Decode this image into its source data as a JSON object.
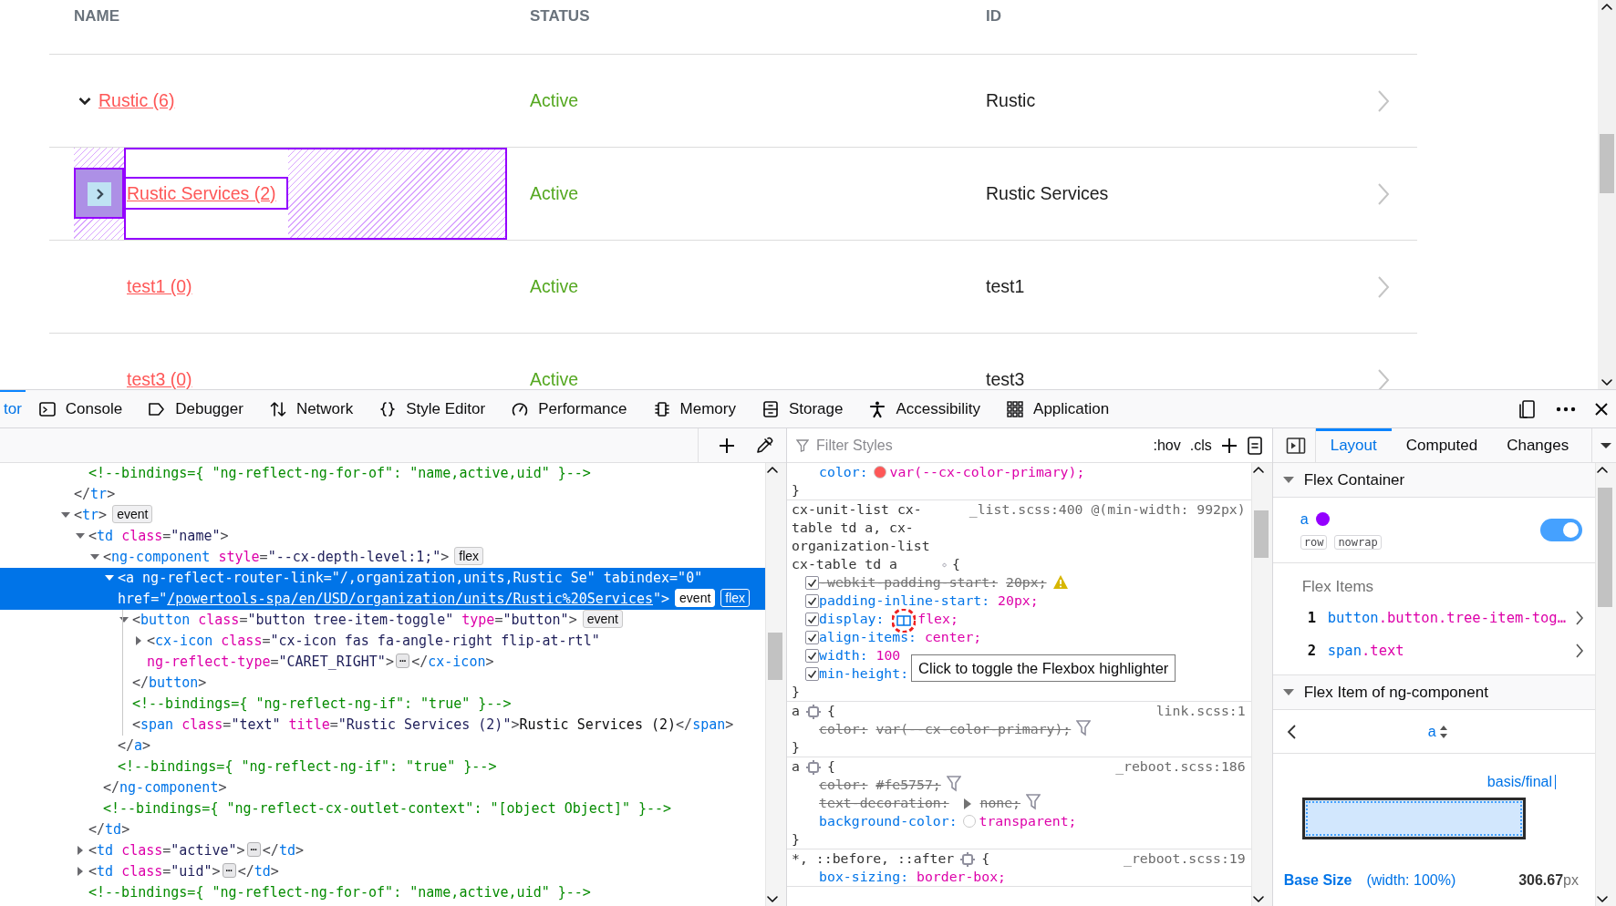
{
  "page": {
    "table": {
      "columns": [
        "NAME",
        "STATUS",
        "ID"
      ],
      "rows": [
        {
          "name": "Rustic (6)",
          "status": "Active",
          "id": "Rustic",
          "expanded": true,
          "highlighted": false,
          "children": [
            {
              "name": "Rustic Services (2)",
              "status": "Active",
              "id": "Rustic Services",
              "expanded": false,
              "highlighted": true
            },
            {
              "name": "test1 (0)",
              "status": "Active",
              "id": "test1",
              "highlighted": false
            },
            {
              "name": "test3 (0)",
              "status": "Active",
              "id": "test3",
              "highlighted": false
            }
          ]
        }
      ]
    }
  },
  "devtools": {
    "toolbar": {
      "tabs": [
        {
          "label": "tor",
          "selected": true
        },
        {
          "label": "Console",
          "selected": false
        },
        {
          "label": "Debugger",
          "selected": false
        },
        {
          "label": "Network",
          "selected": false
        },
        {
          "label": "Style Editor",
          "selected": false
        },
        {
          "label": "Performance",
          "selected": false
        },
        {
          "label": "Memory",
          "selected": false
        },
        {
          "label": "Storage",
          "selected": false
        },
        {
          "label": "Accessibility",
          "selected": false
        },
        {
          "label": "Application",
          "selected": false
        }
      ]
    },
    "markup": {
      "nodes": [
        {
          "children": [
            {
              "selected": false,
              "tokens": [
                {
                  "kind": "cm",
                  "text": "<!--bindings={ \"ng-reflect-ng-for-of\": \"name,active,uid\" }-->"
                }
              ]
            }
          ]
        },
        {
          "selected": false,
          "tokens": [
            {
              "kind": "p",
              "text": "</"
            },
            {
              "kind": "tag",
              "text": "tr"
            },
            {
              "kind": "p",
              "text": ">"
            }
          ]
        },
        {
          "selected": false,
          "expanded": true,
          "tokens": [
            {
              "kind": "p",
              "text": "<"
            },
            {
              "kind": "tag",
              "text": "tr"
            },
            {
              "kind": "p",
              "text": ">"
            },
            {
              "kind": "badge",
              "text": "event",
              "on": false
            }
          ],
          "children": [
            {
              "selected": false,
              "expanded": true,
              "tokens": [
                {
                  "kind": "p",
                  "text": "<"
                },
                {
                  "kind": "tag",
                  "text": "td"
                },
                {
                  "kind": "attr",
                  "text": " class"
                },
                {
                  "kind": "p",
                  "text": "="
                },
                {
                  "kind": "val",
                  "text": "\"name\""
                },
                {
                  "kind": "p",
                  "text": ">"
                }
              ],
              "children": [
                {
                  "selected": false,
                  "expanded": true,
                  "tokens": [
                    {
                      "kind": "p",
                      "text": "<"
                    },
                    {
                      "kind": "tag",
                      "text": "ng-component"
                    },
                    {
                      "kind": "attr",
                      "text": " style"
                    },
                    {
                      "kind": "p",
                      "text": "="
                    },
                    {
                      "kind": "val",
                      "text": "\"--cx-depth-level:1;\""
                    },
                    {
                      "kind": "p",
                      "text": ">"
                    },
                    {
                      "kind": "badge",
                      "text": "flex",
                      "on": false
                    }
                  ],
                  "children": [
                    {
                      "selected": true,
                      "expanded": true,
                      "tokens": [
                        {
                          "kind": "p",
                          "text": "<"
                        },
                        {
                          "kind": "tag",
                          "text": "a"
                        },
                        {
                          "kind": "attr",
                          "text": " ng-reflect-router-link"
                        },
                        {
                          "kind": "p",
                          "text": "="
                        },
                        {
                          "kind": "val",
                          "text": "\"/,organization,units,Rustic Se\""
                        },
                        {
                          "kind": "attr",
                          "text": " tabindex"
                        },
                        {
                          "kind": "p",
                          "text": "="
                        },
                        {
                          "kind": "val",
                          "text": "\"0\""
                        },
                        {
                          "kind": "attr",
                          "text": " href"
                        },
                        {
                          "kind": "p",
                          "text": "=\""
                        },
                        {
                          "kind": "link",
                          "text": "/powertools-spa/en/USD/organization/units/Rustic%20Services"
                        },
                        {
                          "kind": "p",
                          "text": "\">"
                        },
                        {
                          "kind": "badge",
                          "text": "event",
                          "on": false
                        },
                        {
                          "kind": "badge",
                          "text": "flex",
                          "on": true
                        }
                      ],
                      "children": [
                        {
                          "selected": false,
                          "expanded": true,
                          "tokens": [
                            {
                              "kind": "p",
                              "text": "<"
                            },
                            {
                              "kind": "tag",
                              "text": "button"
                            },
                            {
                              "kind": "attr",
                              "text": " class"
                            },
                            {
                              "kind": "p",
                              "text": "="
                            },
                            {
                              "kind": "val",
                              "text": "\"button tree-item-toggle\""
                            },
                            {
                              "kind": "attr",
                              "text": " type"
                            },
                            {
                              "kind": "p",
                              "text": "="
                            },
                            {
                              "kind": "val",
                              "text": "\"button\""
                            },
                            {
                              "kind": "p",
                              "text": ">"
                            },
                            {
                              "kind": "badge",
                              "text": "event",
                              "on": false
                            }
                          ],
                          "children": [
                            {
                              "selected": false,
                              "expanded": false,
                              "tokens": [
                                {
                                  "kind": "p",
                                  "text": "<"
                                },
                                {
                                  "kind": "tag",
                                  "text": "cx-icon"
                                },
                                {
                                  "kind": "attr",
                                  "text": " class"
                                },
                                {
                                  "kind": "p",
                                  "text": "="
                                },
                                {
                                  "kind": "val",
                                  "text": "\"cx-icon fas fa-angle-right flip-at-rtl\""
                                },
                                {
                                  "kind": "attr",
                                  "text": " ng-reflect-type"
                                },
                                {
                                  "kind": "p",
                                  "text": "="
                                },
                                {
                                  "kind": "val",
                                  "text": "\"CARET_RIGHT\""
                                },
                                {
                                  "kind": "p",
                                  "text": ">"
                                },
                                {
                                  "kind": "more",
                                  "text": "⋯"
                                },
                                {
                                  "kind": "p",
                                  "text": "</"
                                },
                                {
                                  "kind": "tag",
                                  "text": "cx-icon"
                                },
                                {
                                  "kind": "p",
                                  "text": ">"
                                }
                              ]
                            }
                          ]
                        },
                        {
                          "selected": false,
                          "tokens": [
                            {
                              "kind": "p",
                              "text": "</"
                            },
                            {
                              "kind": "tag",
                              "text": "button"
                            },
                            {
                              "kind": "p",
                              "text": ">"
                            }
                          ]
                        },
                        {
                          "selected": false,
                          "tokens": [
                            {
                              "kind": "cm",
                              "text": "<!--bindings={ \"ng-reflect-ng-if\": \"true\" }-->"
                            }
                          ]
                        },
                        {
                          "selected": false,
                          "tokens": [
                            {
                              "kind": "p",
                              "text": "<"
                            },
                            {
                              "kind": "tag",
                              "text": "span"
                            },
                            {
                              "kind": "attr",
                              "text": " class"
                            },
                            {
                              "kind": "p",
                              "text": "="
                            },
                            {
                              "kind": "val",
                              "text": "\"text\""
                            },
                            {
                              "kind": "attr",
                              "text": " title"
                            },
                            {
                              "kind": "p",
                              "text": "="
                            },
                            {
                              "kind": "val",
                              "text": "\"Rustic Services (2)\""
                            },
                            {
                              "kind": "p",
                              "text": ">"
                            },
                            {
                              "kind": "text",
                              "text": "Rustic Services (2)"
                            },
                            {
                              "kind": "p",
                              "text": "</"
                            },
                            {
                              "kind": "tag",
                              "text": "span"
                            },
                            {
                              "kind": "p",
                              "text": ">"
                            }
                          ]
                        }
                      ]
                    },
                    {
                      "selected": false,
                      "tokens": [
                        {
                          "kind": "p",
                          "text": "</"
                        },
                        {
                          "kind": "tag",
                          "text": "a"
                        },
                        {
                          "kind": "p",
                          "text": ">"
                        }
                      ]
                    },
                    {
                      "selected": false,
                      "tokens": [
                        {
                          "kind": "cm",
                          "text": "<!--bindings={ \"ng-reflect-ng-if\": \"true\" }-->"
                        }
                      ]
                    }
                  ]
                },
                {
                  "selected": false,
                  "tokens": [
                    {
                      "kind": "p",
                      "text": "</"
                    },
                    {
                      "kind": "tag",
                      "text": "ng-component"
                    },
                    {
                      "kind": "p",
                      "text": ">"
                    }
                  ]
                },
                {
                  "selected": false,
                  "tokens": [
                    {
                      "kind": "cm",
                      "text": "<!--bindings={ \"ng-reflect-cx-outlet-context\": \"[object Object]\" }-->"
                    }
                  ]
                }
              ]
            },
            {
              "selected": false,
              "tokens": [
                {
                  "kind": "p",
                  "text": "</"
                },
                {
                  "kind": "tag",
                  "text": "td"
                },
                {
                  "kind": "p",
                  "text": ">"
                }
              ]
            },
            {
              "selected": false,
              "expanded": false,
              "tokens": [
                {
                  "kind": "p",
                  "text": "<"
                },
                {
                  "kind": "tag",
                  "text": "td"
                },
                {
                  "kind": "attr",
                  "text": " class"
                },
                {
                  "kind": "p",
                  "text": "="
                },
                {
                  "kind": "val",
                  "text": "\"active\""
                },
                {
                  "kind": "p",
                  "text": ">"
                },
                {
                  "kind": "more",
                  "text": "⋯"
                },
                {
                  "kind": "p",
                  "text": "</"
                },
                {
                  "kind": "tag",
                  "text": "td"
                },
                {
                  "kind": "p",
                  "text": ">"
                }
              ]
            },
            {
              "selected": false,
              "expanded": false,
              "tokens": [
                {
                  "kind": "p",
                  "text": "<"
                },
                {
                  "kind": "tag",
                  "text": "td"
                },
                {
                  "kind": "attr",
                  "text": " class"
                },
                {
                  "kind": "p",
                  "text": "="
                },
                {
                  "kind": "val",
                  "text": "\"uid\""
                },
                {
                  "kind": "p",
                  "text": ">"
                },
                {
                  "kind": "more",
                  "text": "⋯"
                },
                {
                  "kind": "p",
                  "text": "</"
                },
                {
                  "kind": "tag",
                  "text": "td"
                },
                {
                  "kind": "p",
                  "text": ">"
                }
              ]
            },
            {
              "selected": false,
              "tokens": [
                {
                  "kind": "cm",
                  "text": "<!--bindings={ \"ng-reflect-ng-for-of\": \"name,active,uid\" }-->"
                }
              ]
            }
          ]
        }
      ]
    },
    "rules": {
      "filter": {
        "placeholder": "Filter Styles"
      },
      "hov": ":hov",
      "cls": ".cls",
      "tooltip": "Click to toggle the Flexbox highlighter",
      "rules": [
        {
          "decls": [
            {
              "prop": "color:",
              "color": "#fe5757",
              "value": "var(--cx-color-primary);",
              "overridden": false
            }
          ],
          "close": "}"
        },
        {
          "selector": "cx-unit-list cx-table td a, cx-organization-list cx-table td a",
          "open": "{",
          "source": "_list.scss:400 @(min-width: 992px)",
          "close": "}",
          "decls": [
            {
              "prop": "-webkit-padding-start:",
              "value": "20px;",
              "overridden": true,
              "warning": true,
              "enabled": true
            },
            {
              "prop": "padding-inline-start:",
              "value": "20px;",
              "overridden": false,
              "enabled": true
            },
            {
              "prop": "display:",
              "value": "flex;",
              "overridden": false,
              "enabled": true,
              "flex_toggle": true
            },
            {
              "prop": "align-items:",
              "value": "center;",
              "overridden": false,
              "enabled": true
            },
            {
              "prop": "width:",
              "value": "100",
              "overridden": false,
              "enabled": true
            },
            {
              "prop": "min-height:",
              "overridden": false,
              "enabled": true
            }
          ]
        },
        {
          "selector": "a",
          "open": "{",
          "source": "link.scss:1",
          "close": "}",
          "decls": [
            {
              "prop": "color:",
              "value": "var(--cx-color-primary);",
              "overridden": true
            }
          ]
        },
        {
          "selector": "a",
          "open": "{",
          "source": "_reboot.scss:186",
          "close": "}",
          "decls": [
            {
              "prop": "color:",
              "value": "#fe5757;",
              "overridden": true
            },
            {
              "prop": "text-decoration:",
              "value": "none;",
              "overridden": true,
              "expandable": true
            },
            {
              "prop": "background-color:",
              "color": "#ffffff",
              "value": "transparent;",
              "overridden": false
            }
          ]
        },
        {
          "selector": "*, ::before, ::after",
          "open": "{",
          "source": "_reboot.scss:19",
          "decls": [
            {
              "prop": "box-sizing:",
              "value": "border-box;",
              "overridden": false
            }
          ]
        }
      ]
    },
    "sidebar": {
      "tabs": [
        {
          "label": "Layout",
          "selected": true
        },
        {
          "label": "Computed",
          "selected": false
        },
        {
          "label": "Changes",
          "selected": false
        }
      ],
      "flex_container": {
        "title": "Flex Container",
        "expanded": true,
        "element": "a",
        "color": "#9400ff",
        "badges": [
          "row",
          "nowrap"
        ],
        "highlighter_on": true,
        "items_title": "Flex Items",
        "items": [
          {
            "index": "1",
            "tag": "button",
            "classes": ".button.tree-item-tog…"
          },
          {
            "index": "2",
            "tag": "span",
            "classes": ".text"
          }
        ]
      },
      "flex_item": {
        "title": "Flex Item of ng-component",
        "expanded": true,
        "element": "a",
        "basis_label": "basis/final",
        "base_size": {
          "label": "Base Size",
          "note": "(width: 100%)",
          "value": "306.67",
          "unit": "px"
        }
      }
    }
  }
}
